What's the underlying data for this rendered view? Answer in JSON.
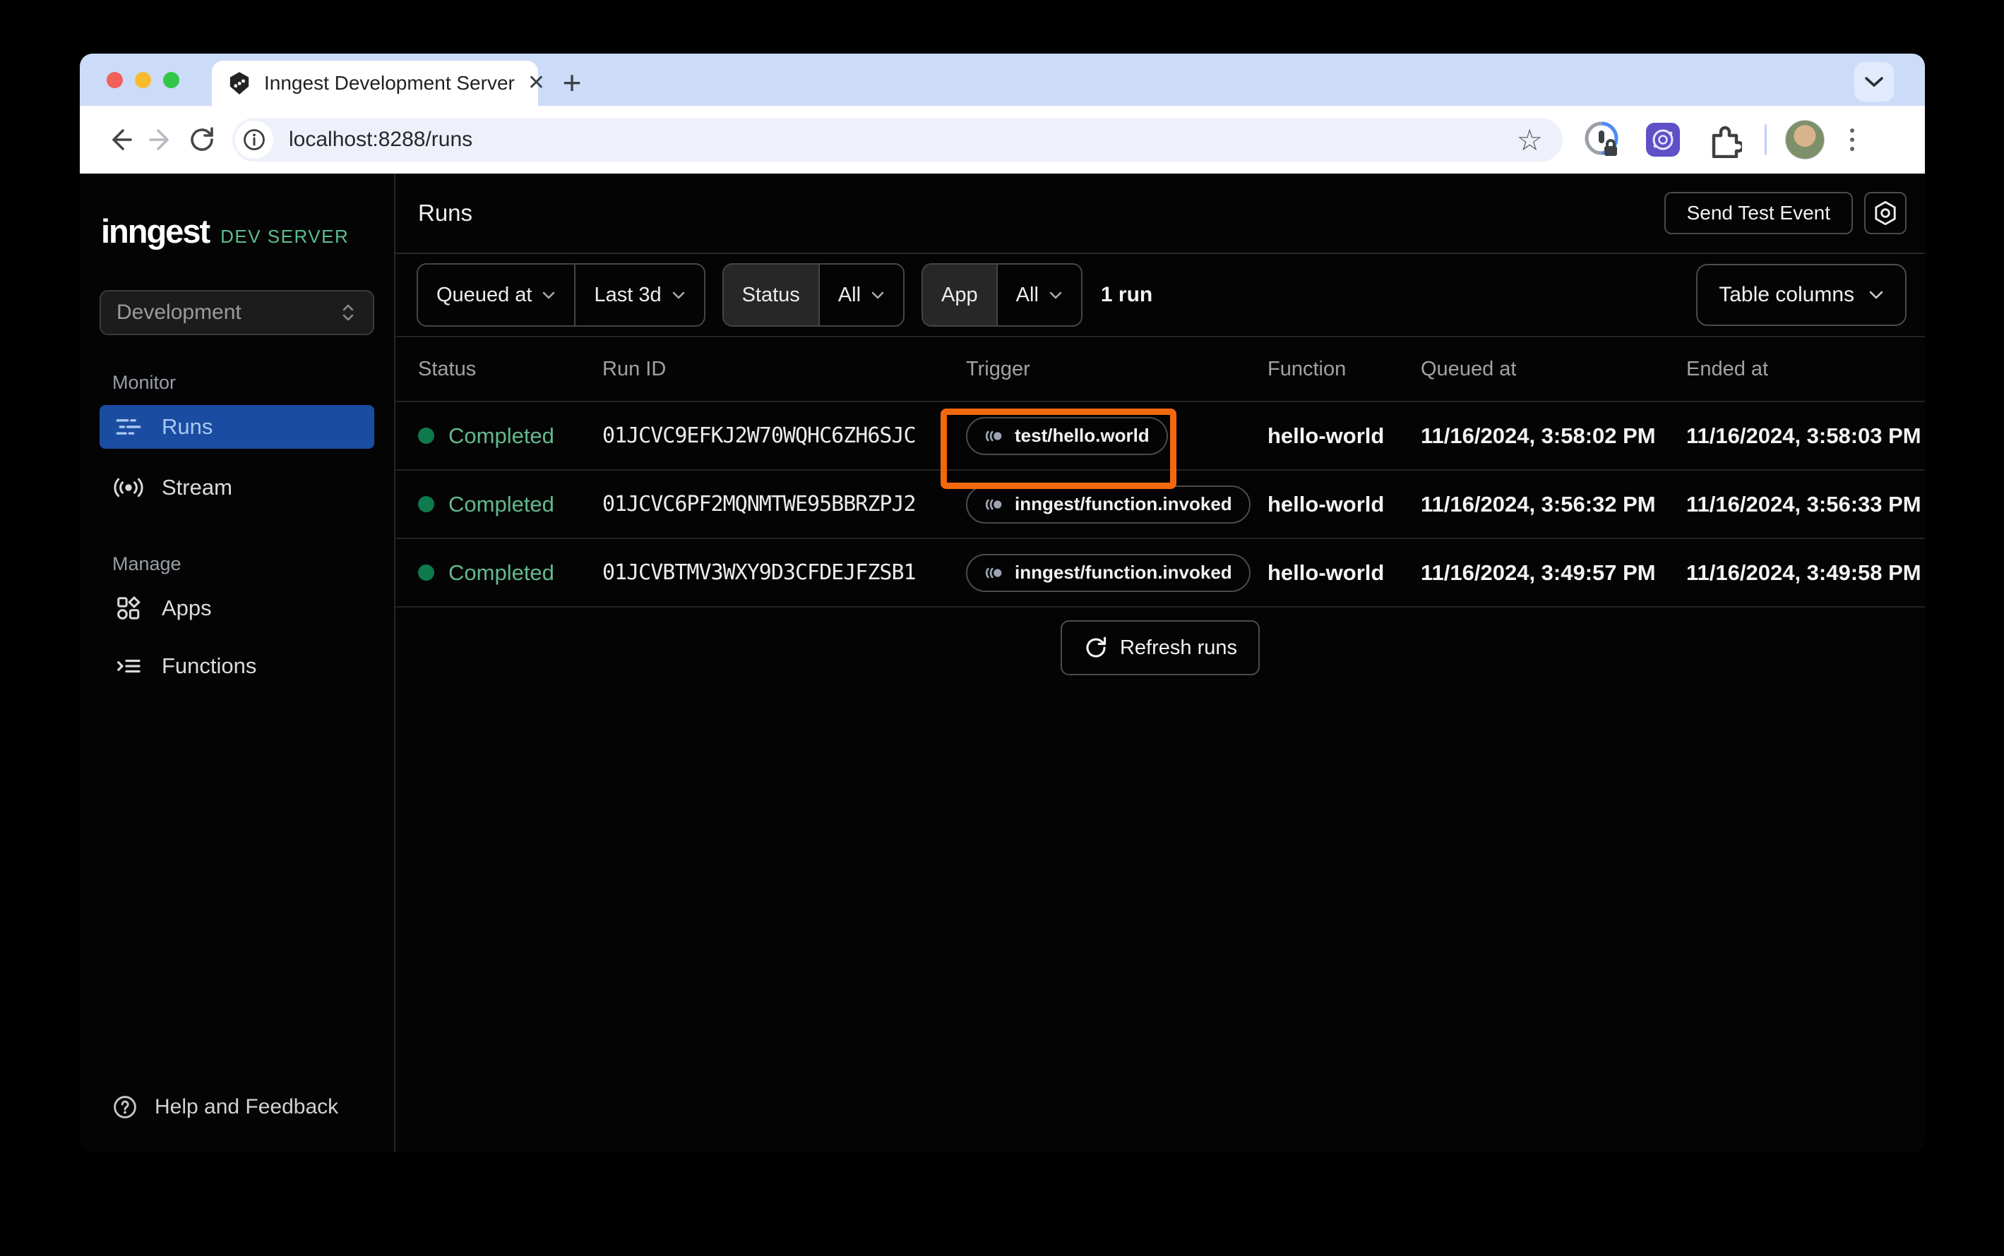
{
  "colors": {
    "accent_blue": "#1a4da1",
    "accent_blue_text": "#a9c8f2",
    "status_green_dot": "#0e7a4e",
    "status_green_text": "#63b98e",
    "highlight_orange": "#f2690d",
    "dev_server_green": "#5cbd8f",
    "tabstrip_bg": "#ccdcf8"
  },
  "browser": {
    "tab_title": "Inngest Development Server",
    "url": "localhost:8288/runs",
    "icons": {
      "close": "✕",
      "new_tab": "+",
      "star": "☆",
      "favicon": "inngest-logo"
    }
  },
  "sidebar": {
    "logo_text": "inngest",
    "logo_badge": "DEV SERVER",
    "env_select_value": "Development",
    "section_monitor": "Monitor",
    "item_runs": "Runs",
    "item_stream": "Stream",
    "section_manage": "Manage",
    "item_apps": "Apps",
    "item_functions": "Functions",
    "footer_help": "Help and Feedback"
  },
  "header": {
    "title": "Runs",
    "send_test_event_label": "Send Test Event"
  },
  "filters": {
    "queued_at_label": "Queued at",
    "time_range_value": "Last 3d",
    "status_label": "Status",
    "status_value": "All",
    "app_label": "App",
    "app_value": "All",
    "run_count": "1 run",
    "table_columns_label": "Table columns"
  },
  "table": {
    "columns": [
      "Status",
      "Run ID",
      "Trigger",
      "Function",
      "Queued at",
      "Ended at"
    ],
    "rows": [
      {
        "status": "Completed",
        "run_id": "01JCVC9EFKJ2W70WQHC6ZH6SJC",
        "trigger": "test/hello.world",
        "function": "hello-world",
        "queued_at": "11/16/2024, 3:58:02 PM",
        "ended_at": "11/16/2024, 3:58:03 PM",
        "highlighted": true
      },
      {
        "status": "Completed",
        "run_id": "01JCVC6PF2MQNMTWE95BBRZPJ2",
        "trigger": "inngest/function.invoked",
        "function": "hello-world",
        "queued_at": "11/16/2024, 3:56:32 PM",
        "ended_at": "11/16/2024, 3:56:33 PM",
        "highlighted": false
      },
      {
        "status": "Completed",
        "run_id": "01JCVBTMV3WXY9D3CFDEJFZSB1",
        "trigger": "inngest/function.invoked",
        "function": "hello-world",
        "queued_at": "11/16/2024, 3:49:57 PM",
        "ended_at": "11/16/2024, 3:49:58 PM",
        "highlighted": false
      }
    ],
    "refresh_button_label": "Refresh runs"
  }
}
